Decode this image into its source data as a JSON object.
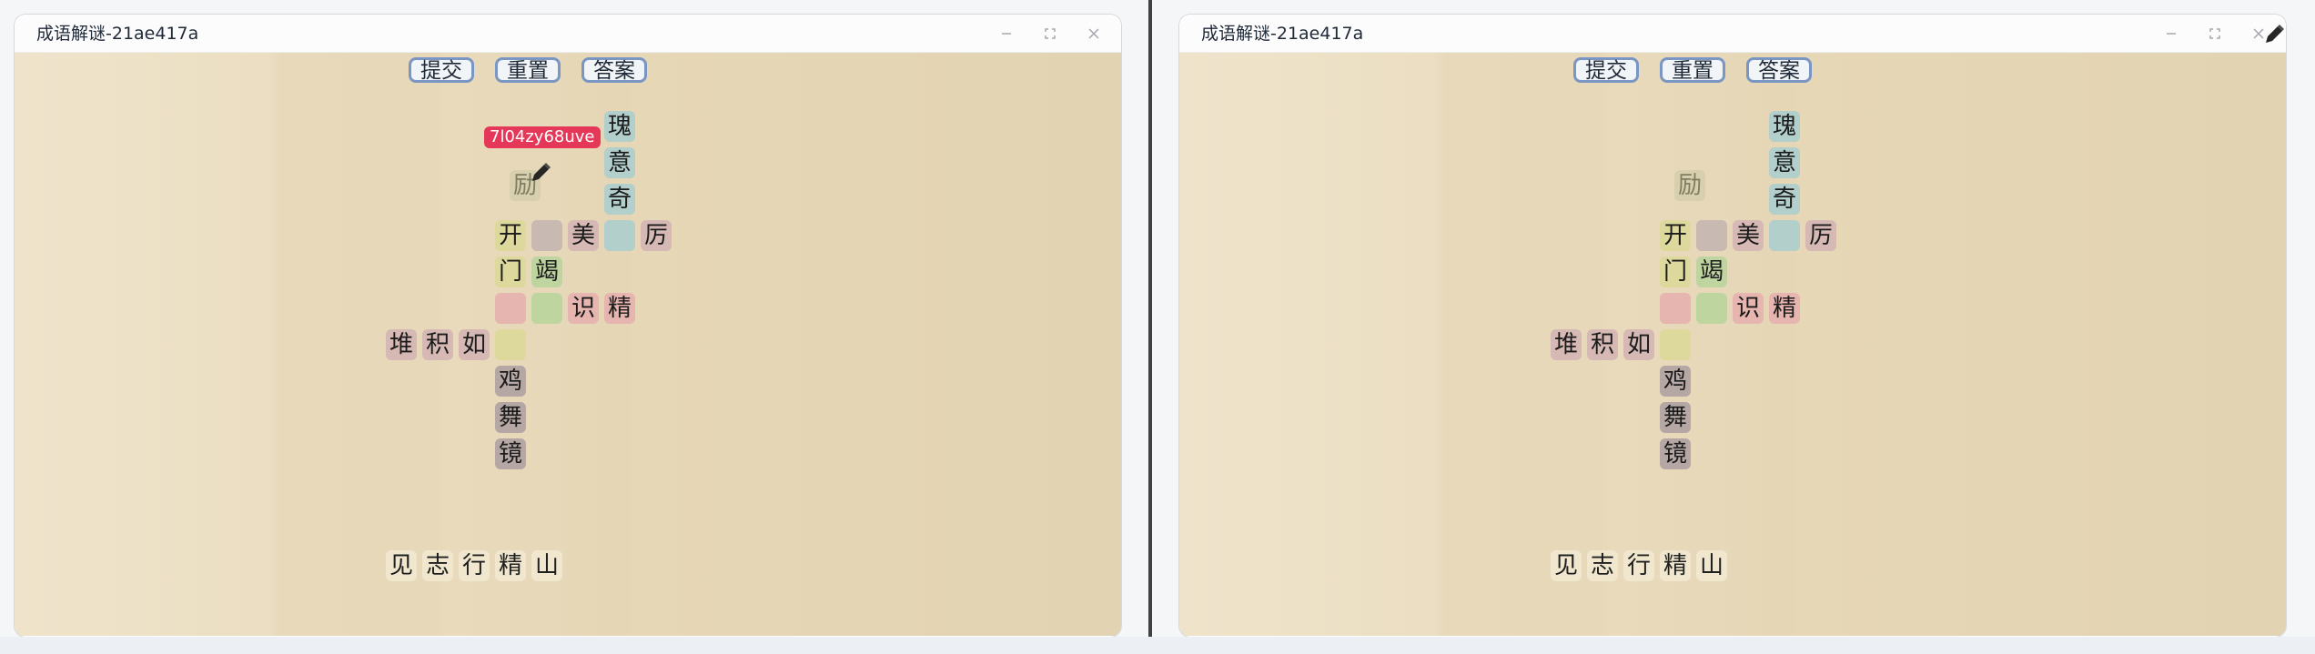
{
  "left_window": {
    "title": "成语解谜-21ae417a",
    "buttons": {
      "submit": "提交",
      "reset": "重置",
      "answer": "答案"
    },
    "hint": "7l04zy68uve",
    "grid": {
      "c1": "瑰",
      "c2": "意",
      "c3": "奇",
      "c4": "励",
      "c5": "开",
      "c6": "",
      "c7": "美",
      "c8": "",
      "c9": "厉",
      "c10": "门",
      "c11": "竭",
      "c12": "",
      "c13": "",
      "c14": "识",
      "c15": "精",
      "c16": "堆",
      "c17": "积",
      "c18": "如",
      "c19": "",
      "c20": "鸡",
      "c21": "舞",
      "c22": "镜"
    },
    "word_bank": [
      "见",
      "志",
      "行",
      "精",
      "山"
    ]
  },
  "right_window": {
    "title": "成语解谜-21ae417a",
    "buttons": {
      "submit": "提交",
      "reset": "重置",
      "answer": "答案"
    },
    "grid": {
      "c1": "瑰",
      "c2": "意",
      "c3": "奇",
      "c4": "励",
      "c5": "开",
      "c6": "",
      "c7": "美",
      "c8": "",
      "c9": "厉",
      "c10": "门",
      "c11": "竭",
      "c12": "",
      "c13": "",
      "c14": "识",
      "c15": "精",
      "c16": "堆",
      "c17": "积",
      "c18": "如",
      "c19": "",
      "c20": "鸡",
      "c21": "舞",
      "c22": "镜"
    },
    "word_bank": [
      "见",
      "志",
      "行",
      "精",
      "山"
    ]
  },
  "icons": {
    "minimize": "minimize-icon",
    "maximize": "maximize-icon",
    "close": "close-icon",
    "pencil": "pencil-icon"
  },
  "colors": {
    "hint_badge": "#e53858",
    "button_border": "#7a96c3",
    "teal": "#b2cfcc",
    "yellow": "#ddd89b",
    "green": "#bfd5a0",
    "pink": "#e7b5b0",
    "mauve": "#d6b9b4",
    "gray": "#c8b9b3",
    "dark_gray": "#b5a7a3"
  }
}
